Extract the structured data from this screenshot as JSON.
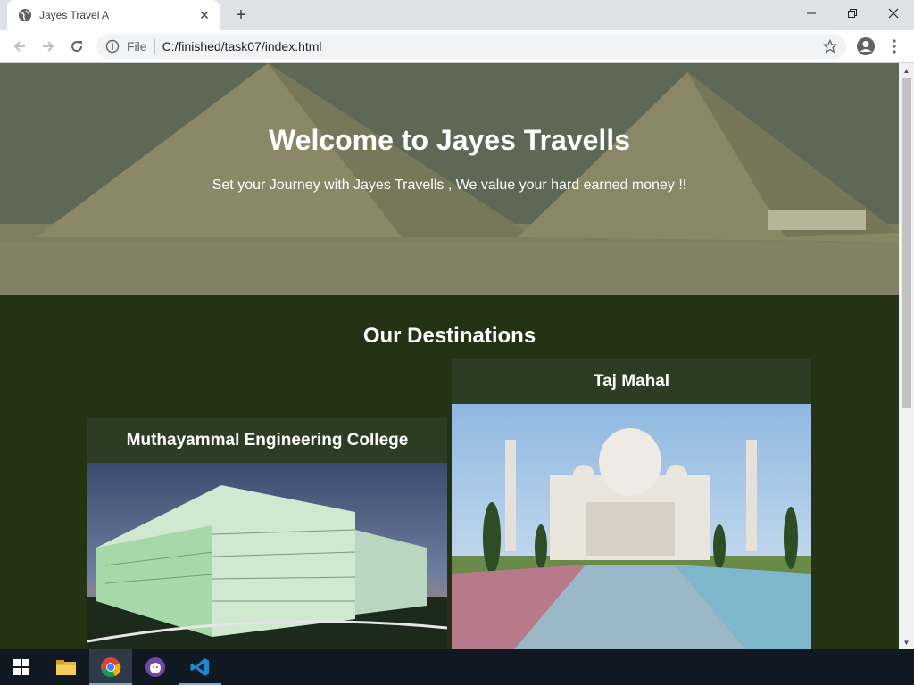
{
  "browser": {
    "tab_title": "Jayes Travel A",
    "url_scheme": "File",
    "url": "C:/finished/task07/index.html"
  },
  "page": {
    "hero_title": "Welcome to Jayes Travells",
    "hero_subtitle": "Set your Journey with Jayes Travells , We value your hard earned money !!",
    "section_title": "Our Destinations",
    "destinations": [
      {
        "name": "Muthayammal Engineering College"
      },
      {
        "name": "Taj Mahal"
      }
    ]
  },
  "taskbar": {
    "items": [
      "start-icon",
      "file-explorer-icon",
      "chrome-icon",
      "github-desktop-icon",
      "vscode-icon"
    ]
  },
  "colors": {
    "page_bg": "#253315",
    "card_bg": "#2c3d24",
    "taskbar_bg": "#101822"
  }
}
